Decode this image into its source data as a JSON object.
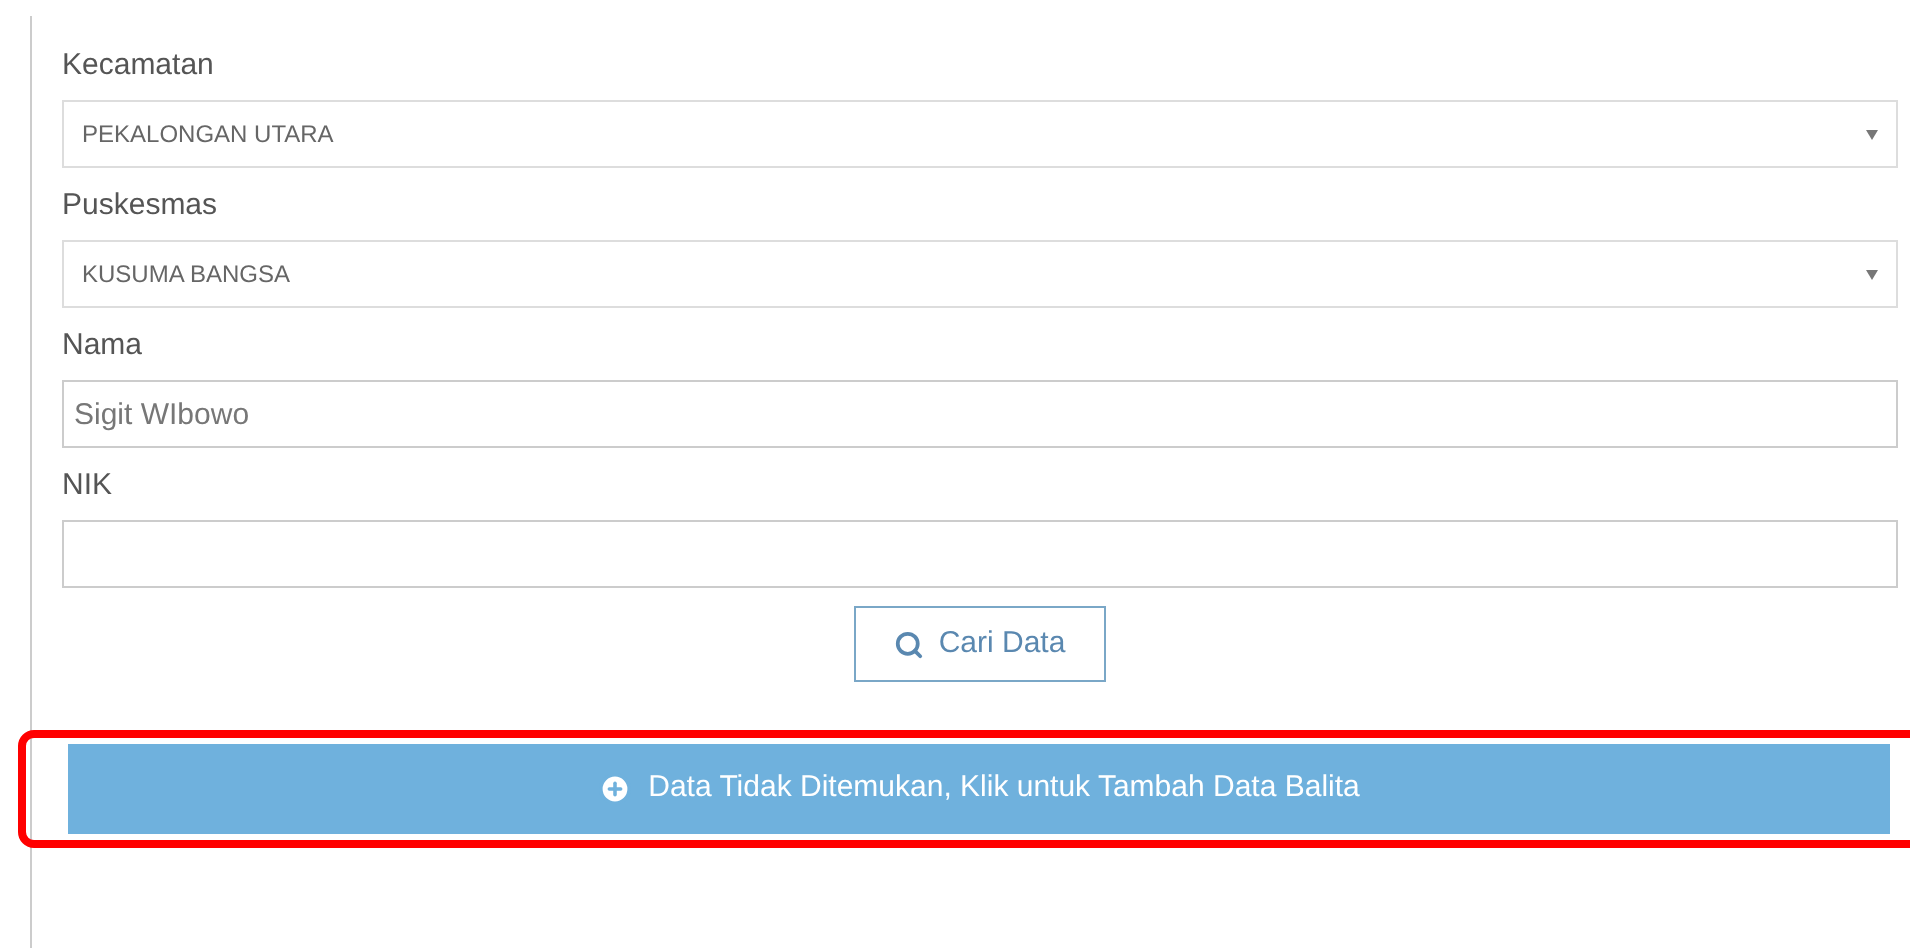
{
  "fields": [
    {
      "kind": "select",
      "label": "Kecamatan",
      "value": "PEKALONGAN UTARA"
    },
    {
      "kind": "select",
      "label": "Puskesmas",
      "value": "KUSUMA BANGSA"
    },
    {
      "kind": "text",
      "label": "Nama",
      "value": "Sigit WIbowo"
    },
    {
      "kind": "text",
      "label": "NIK"
    }
  ],
  "search_button": {
    "label": "Cari Data"
  },
  "add_button": {
    "label": "Data Tidak Ditemukan, Klik untuk Tambah Data Balita",
    "highlighted": true
  }
}
